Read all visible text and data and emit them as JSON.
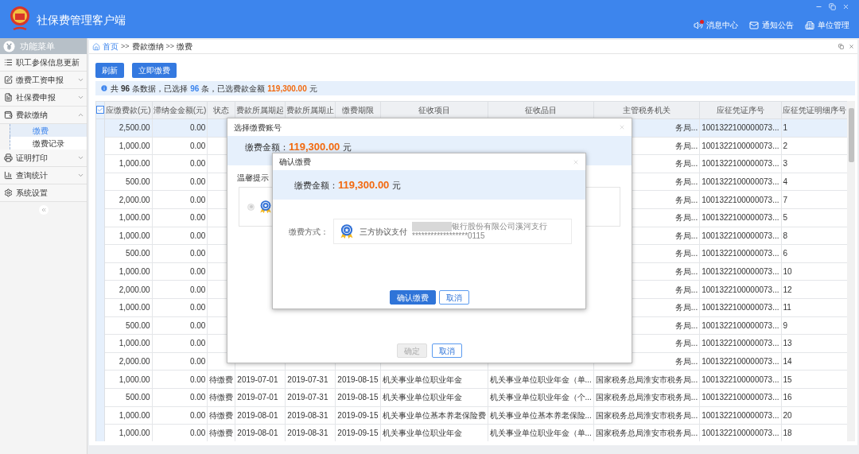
{
  "app": {
    "title": "社保费管理客户端",
    "header_links": [
      {
        "label": "消息中心",
        "kind": "message",
        "unread": true
      },
      {
        "label": "通知公告",
        "kind": "notice",
        "unread": false
      },
      {
        "label": "单位管理",
        "kind": "unit",
        "unread": false
      }
    ]
  },
  "sidebar": {
    "title": "功能菜单",
    "items": [
      {
        "label": "职工参保信息更新",
        "kind": "list"
      },
      {
        "label": "缴费工资申报",
        "kind": "edit",
        "expanded": false
      },
      {
        "label": "社保费申报",
        "kind": "doc",
        "expanded": false
      },
      {
        "label": "费款缴纳",
        "kind": "pay",
        "expanded": true,
        "children": [
          {
            "label": "缴费",
            "selected": true
          },
          {
            "label": "缴费记录",
            "selected": false
          }
        ]
      },
      {
        "label": "证明打印",
        "kind": "print",
        "expanded": false
      },
      {
        "label": "查询统计",
        "kind": "chart",
        "expanded": false
      },
      {
        "label": "系统设置",
        "kind": "gear"
      }
    ]
  },
  "breadcrumb": [
    {
      "label": "首页",
      "kind": "link"
    },
    {
      "label": ">>",
      "kind": "sep"
    },
    {
      "label": "费款缴纳",
      "kind": "crumb"
    },
    {
      "label": ">>",
      "kind": "sep"
    },
    {
      "label": "缴费",
      "kind": "crumb"
    }
  ],
  "toolbar": [
    "刷新",
    "立即缴费"
  ],
  "info": [
    {
      "text": "共",
      "kind": "plain"
    },
    {
      "text": "96",
      "kind": "count"
    },
    {
      "text": "条数据，已选择",
      "kind": "plain"
    },
    {
      "text": "96",
      "kind": "selected"
    },
    {
      "text": "条，已选费款金额",
      "kind": "plain"
    },
    {
      "text": "119,300.00",
      "kind": "amount"
    },
    {
      "text": "元",
      "kind": "plain"
    }
  ],
  "table": {
    "all_checked": true,
    "columns": [
      "应缴费款(元)",
      "滞纳金金额(元)",
      "状态",
      "费款所属期起",
      "费款所属期止",
      "缴费期限",
      "征收项目",
      "征收品目",
      "主管税务机关",
      "应征凭证序号",
      "应征凭证明细序号"
    ],
    "rows": [
      {
        "selected": true,
        "amount": "2,500.00",
        "late_fee": "0.00",
        "office": "务局...",
        "voucher": "1001322100000073...",
        "detail": "1"
      },
      {
        "selected": false,
        "amount": "1,000.00",
        "late_fee": "0.00",
        "office": "务局...",
        "voucher": "1001322100000073...",
        "detail": "2"
      },
      {
        "selected": false,
        "amount": "1,000.00",
        "late_fee": "0.00",
        "office": "务局...",
        "voucher": "1001322100000073...",
        "detail": "3"
      },
      {
        "selected": false,
        "amount": "500.00",
        "late_fee": "0.00",
        "office": "务局...",
        "voucher": "1001322100000073...",
        "detail": "4"
      },
      {
        "selected": false,
        "amount": "2,000.00",
        "late_fee": "0.00",
        "office": "务局...",
        "voucher": "1001322100000073...",
        "detail": "7"
      },
      {
        "selected": false,
        "amount": "1,000.00",
        "late_fee": "0.00",
        "office": "务局...",
        "voucher": "1001322100000073...",
        "detail": "5"
      },
      {
        "selected": false,
        "amount": "1,000.00",
        "late_fee": "0.00",
        "office": "务局...",
        "voucher": "1001322100000073...",
        "detail": "8"
      },
      {
        "selected": false,
        "amount": "500.00",
        "late_fee": "0.00",
        "office": "务局...",
        "voucher": "1001322100000073...",
        "detail": "6"
      },
      {
        "selected": false,
        "amount": "1,000.00",
        "late_fee": "0.00",
        "office": "务局...",
        "voucher": "1001322100000073...",
        "detail": "10"
      },
      {
        "selected": false,
        "amount": "2,000.00",
        "late_fee": "0.00",
        "office": "务局...",
        "voucher": "1001322100000073...",
        "detail": "12"
      },
      {
        "selected": false,
        "amount": "1,000.00",
        "late_fee": "0.00",
        "office": "务局...",
        "voucher": "1001322100000073...",
        "detail": "11"
      },
      {
        "selected": false,
        "amount": "500.00",
        "late_fee": "0.00",
        "office": "务局...",
        "voucher": "1001322100000073...",
        "detail": "9"
      },
      {
        "selected": false,
        "amount": "1,000.00",
        "late_fee": "0.00",
        "office": "务局...",
        "voucher": "1001322100000073...",
        "detail": "13"
      },
      {
        "selected": false,
        "amount": "2,000.00",
        "late_fee": "0.00",
        "office": "务局...",
        "voucher": "1001322100000073...",
        "detail": "14"
      },
      {
        "selected": false,
        "amount": "1,000.00",
        "late_fee": "0.00",
        "status": "待缴费",
        "start": "2019-07-01",
        "end": "2019-07-31",
        "due": "2019-08-15",
        "item": "机关事业单位职业年金",
        "subitem": "机关事业单位职业年金（单...",
        "office": "国家税务总局淮安市税务局...",
        "voucher": "1001322100000073...",
        "detail": "15"
      },
      {
        "selected": false,
        "amount": "500.00",
        "late_fee": "0.00",
        "status": "待缴费",
        "start": "2019-07-01",
        "end": "2019-07-31",
        "due": "2019-08-15",
        "item": "机关事业单位职业年金",
        "subitem": "机关事业单位职业年金（个...",
        "office": "国家税务总局淮安市税务局...",
        "voucher": "1001322100000073...",
        "detail": "16"
      },
      {
        "selected": false,
        "amount": "1,000.00",
        "late_fee": "0.00",
        "status": "待缴费",
        "start": "2019-08-01",
        "end": "2019-08-31",
        "due": "2019-09-15",
        "item": "机关事业单位基本养老保险费",
        "subitem": "机关事业单位基本养老保险...",
        "office": "国家税务总局淮安市税务局...",
        "voucher": "1001322100000073...",
        "detail": "20"
      },
      {
        "selected": false,
        "amount": "1,000.00",
        "late_fee": "0.00",
        "status": "待缴费",
        "start": "2019-08-01",
        "end": "2019-08-31",
        "due": "2019-09-15",
        "item": "机关事业单位职业年金",
        "subitem": "机关事业单位职业年金（单...",
        "office": "国家税务总局淮安市税务局...",
        "voucher": "1001322100000073...",
        "detail": "18"
      }
    ]
  },
  "account_dialog": {
    "title": "选择缴费账号",
    "amount_label": "缴费金额：",
    "amount": "119,300.00",
    "unit": "元",
    "tip_label": "温馨提示",
    "options": [
      {
        "selected": false
      }
    ],
    "buttons": [
      {
        "label": "确定",
        "kind": "primary",
        "disabled": true
      },
      {
        "label": "取消",
        "kind": "secondary",
        "disabled": false
      }
    ]
  },
  "confirm_dialog": {
    "title": "确认缴费",
    "amount_label": "缴费金额：",
    "amount": "119,300.00",
    "unit": "元",
    "method_label": "缴费方式：",
    "method": {
      "name": "三方协议支付",
      "bank": "银行股份有限公司溪河支行",
      "account": "******************0115"
    },
    "buttons": [
      {
        "label": "确认缴费",
        "kind": "primary",
        "disabled": false
      },
      {
        "label": "取消",
        "kind": "secondary",
        "disabled": false
      }
    ]
  }
}
